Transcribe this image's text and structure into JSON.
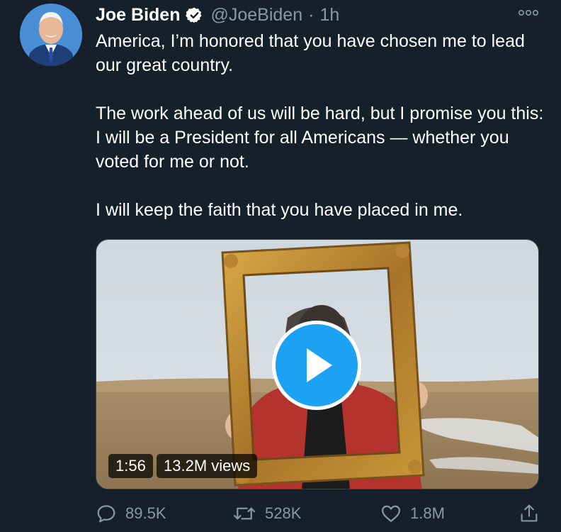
{
  "tweet": {
    "author_name": "Joe Biden",
    "verified_icon": "verified-badge-icon",
    "handle": "@JoeBiden",
    "separator": "·",
    "time": "1h",
    "paragraphs": [
      "America, I’m honored that you have chosen me to lead our great country.",
      "The work ahead of us will be hard, but I promise you this: I will be a President for all Americans — whether you voted for me or not.",
      "I will keep the faith that you have placed in me."
    ]
  },
  "video": {
    "duration": "1:56",
    "views": "13.2M views",
    "play_icon": "play-icon"
  },
  "actions": {
    "replies": "89.5K",
    "retweets": "528K",
    "likes": "1.8M",
    "reply_icon": "reply-icon",
    "retweet_icon": "retweet-icon",
    "like_icon": "heart-icon",
    "share_icon": "share-icon"
  },
  "colors": {
    "background": "#15202b",
    "text": "#ffffff",
    "secondary_text": "#8899a6",
    "accent": "#1da1f2"
  }
}
